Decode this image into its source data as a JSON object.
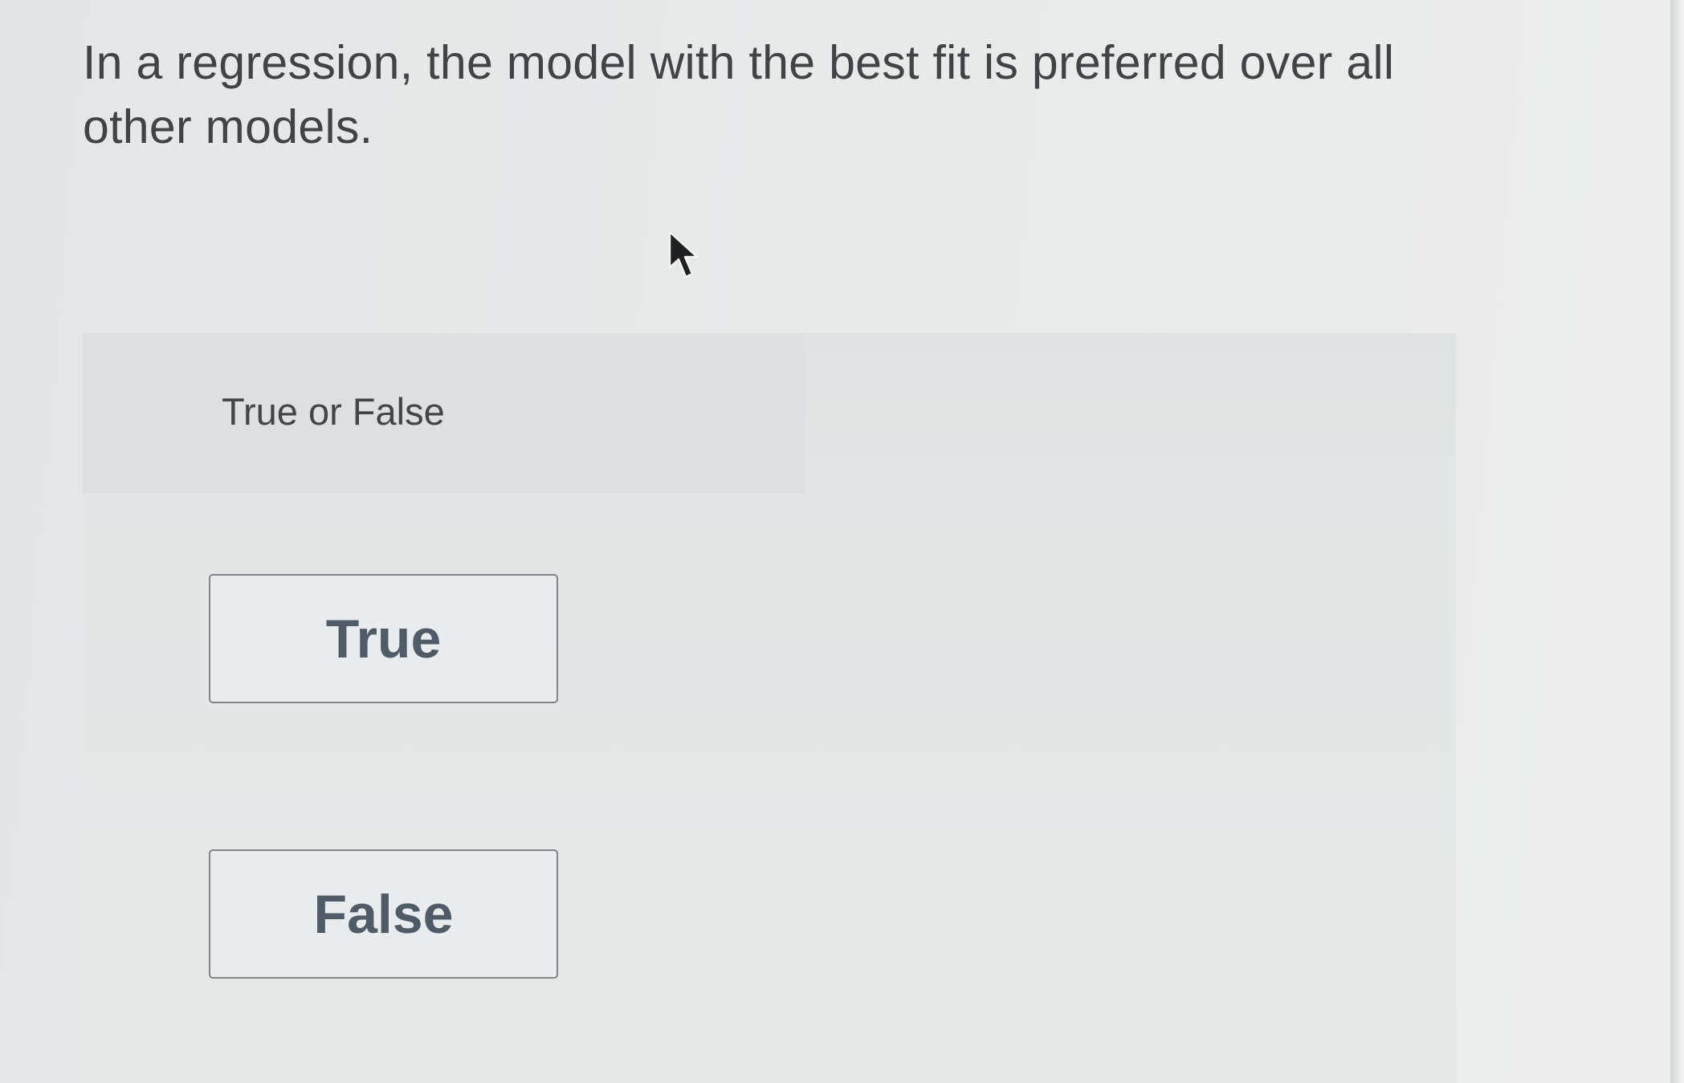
{
  "question": {
    "text": "In a regression, the model with the best fit is preferred over all other models."
  },
  "prompt": {
    "label": "True or False"
  },
  "options": [
    {
      "label": "True"
    },
    {
      "label": "False"
    }
  ],
  "cursor": {
    "icon": "mouse-pointer-icon"
  }
}
